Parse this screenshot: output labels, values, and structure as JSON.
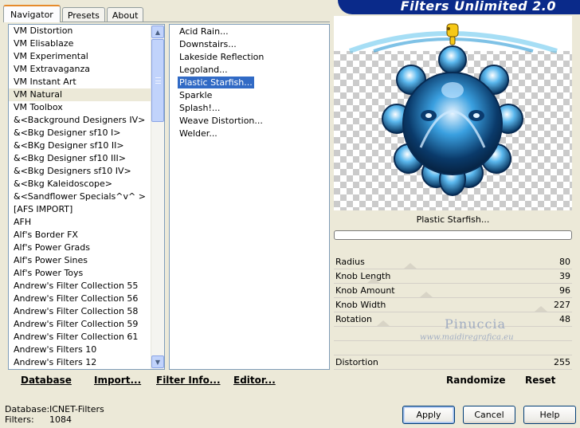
{
  "banner": {
    "title": "Filters Unlimited 2.0"
  },
  "tabs": [
    {
      "label": "Navigator",
      "active": true
    },
    {
      "label": "Presets",
      "active": false
    },
    {
      "label": "About",
      "active": false
    }
  ],
  "categories": [
    "VM Distortion",
    "VM Elisablaze",
    "VM Experimental",
    "VM Extravaganza",
    "VM Instant Art",
    "VM Natural",
    "VM Toolbox",
    "&<Background Designers IV>",
    "&<Bkg Designer sf10 I>",
    "&<BKg Designer sf10 II>",
    "&<Bkg Designer sf10 III>",
    "&<Bkg Designers sf10 IV>",
    "&<Bkg Kaleidoscope>",
    "&<Sandflower Specials^v^ >",
    "[AFS IMPORT]",
    "AFH",
    "Alf's Border FX",
    "Alf's Power Grads",
    "Alf's Power Sines",
    "Alf's Power Toys",
    "Andrew's Filter Collection 55",
    "Andrew's Filter Collection 56",
    "Andrew's Filter Collection 58",
    "Andrew's Filter Collection 59",
    "Andrew's Filter Collection 61",
    "Andrew's Filters 10",
    "Andrew's Filters 12"
  ],
  "selected_category": "VM Natural",
  "filters": [
    "Acid Rain...",
    "Downstairs...",
    "Lakeside Reflection",
    "Legoland...",
    "Plastic Starfish...",
    "Sparkle",
    "Splash!...",
    "Weave Distortion...",
    "Welder..."
  ],
  "selected_filter": "Plastic Starfish...",
  "left_buttons": {
    "database": "Database",
    "import": "Import...",
    "filter_info": "Filter Info...",
    "editor": "Editor..."
  },
  "preview": {
    "filter_name": "Plastic Starfish..."
  },
  "sliders": [
    {
      "label": "Radius",
      "value": "80",
      "fraction": 0.31
    },
    {
      "label": "Knob Length",
      "value": "39",
      "fraction": 0.15
    },
    {
      "label": "Knob Amount",
      "value": "96",
      "fraction": 0.38
    },
    {
      "label": "Knob Width",
      "value": "227",
      "fraction": 0.89
    },
    {
      "label": "Rotation",
      "value": "48",
      "fraction": 0.19
    },
    {
      "label": "",
      "value": "",
      "fraction": null
    },
    {
      "label": "",
      "value": "",
      "fraction": null
    },
    {
      "label": "Distortion",
      "value": "255",
      "fraction": null
    }
  ],
  "watermark": {
    "line1": "Pinuccia",
    "line2": "www.maidiregrafica.eu"
  },
  "right_buttons": {
    "randomize": "Randomize",
    "reset": "Reset"
  },
  "status": {
    "database_label": "Database:",
    "database_value": "ICNET-Filters",
    "filters_label": "Filters:",
    "filters_value": "1084"
  },
  "dialog": {
    "apply": "Apply",
    "cancel": "Cancel",
    "help": "Help"
  },
  "colors": {
    "selection": "#316ac5",
    "banner": "#0a2a8a",
    "dialog_bg": "#ece9d8",
    "active_tab_accent": "#e68b2c"
  },
  "icons": {
    "pointer": "pointing-hand-icon",
    "scroll_up": "scroll-up-arrow-icon",
    "scroll_down": "scroll-down-arrow-icon"
  }
}
